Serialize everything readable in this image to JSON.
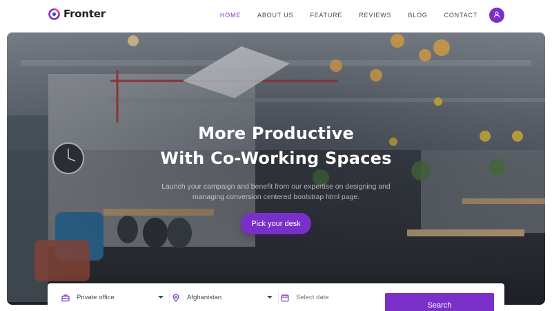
{
  "brand": {
    "name": "Fronter",
    "logo_icon": "fronter-logo-icon",
    "accent": "#7b2fc9"
  },
  "nav": {
    "items": [
      {
        "label": "HOME",
        "active": true
      },
      {
        "label": "ABOUT US",
        "active": false
      },
      {
        "label": "FEATURE",
        "active": false
      },
      {
        "label": "REVIEWS",
        "active": false
      },
      {
        "label": "BLOG",
        "active": false
      },
      {
        "label": "CONTACT",
        "active": false
      }
    ],
    "user_icon": "user-icon"
  },
  "hero": {
    "title_line1": "More Productive",
    "title_line2": "With Co-Working Spaces",
    "subtitle_line1": "Launch your campaign and benefit from our expertise on designing and",
    "subtitle_line2": "managing conversion centered bootstrap html page.",
    "cta_label": "Pick your desk"
  },
  "search": {
    "space_type": {
      "value": "Private office",
      "icon": "briefcase-icon"
    },
    "location": {
      "value": "Afghanistan",
      "icon": "map-pin-icon"
    },
    "date": {
      "placeholder": "Select date",
      "icon": "calendar-icon"
    },
    "button_label": "Search"
  },
  "colors": {
    "primary": "#7b2fc9",
    "text_dark": "#1d2128",
    "nav_text": "#3c4858"
  }
}
